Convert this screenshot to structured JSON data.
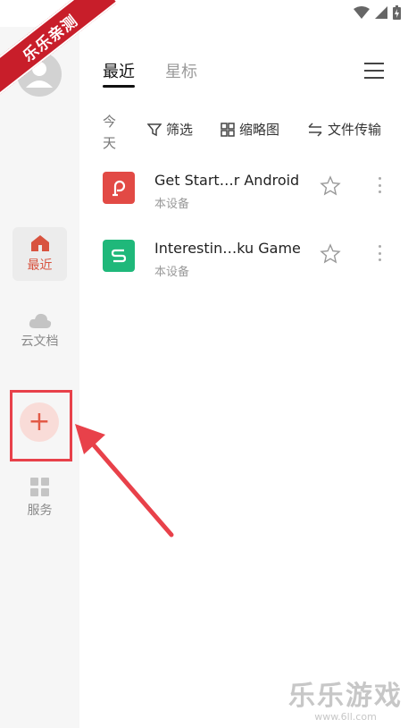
{
  "watermark": {
    "corner": "乐乐亲测",
    "brand": "乐乐游戏",
    "url": "www.6ll.com"
  },
  "rail": {
    "items": [
      {
        "label": "最近",
        "icon": "home-icon"
      },
      {
        "label": "云文档",
        "icon": "cloud-icon"
      },
      {
        "label": "服务",
        "icon": "grid-icon"
      }
    ],
    "add_label": "+"
  },
  "tabs": [
    {
      "label": "最近"
    },
    {
      "label": "星标"
    }
  ],
  "toolbar": {
    "date": "今天",
    "filter": "筛选",
    "thumbnail": "缩略图",
    "transfer": "文件传输"
  },
  "files": [
    {
      "name": "Get Start…r Android",
      "location": "本设备",
      "type": "presentation",
      "color": "#e24a45",
      "icon": "presentation-file-icon"
    },
    {
      "name": "Interestin…ku Game",
      "location": "本设备",
      "type": "spreadsheet",
      "color": "#1fb87a",
      "icon": "spreadsheet-file-icon"
    }
  ],
  "colors": {
    "accent": "#d8533f",
    "highlight_box": "#e8414a"
  }
}
